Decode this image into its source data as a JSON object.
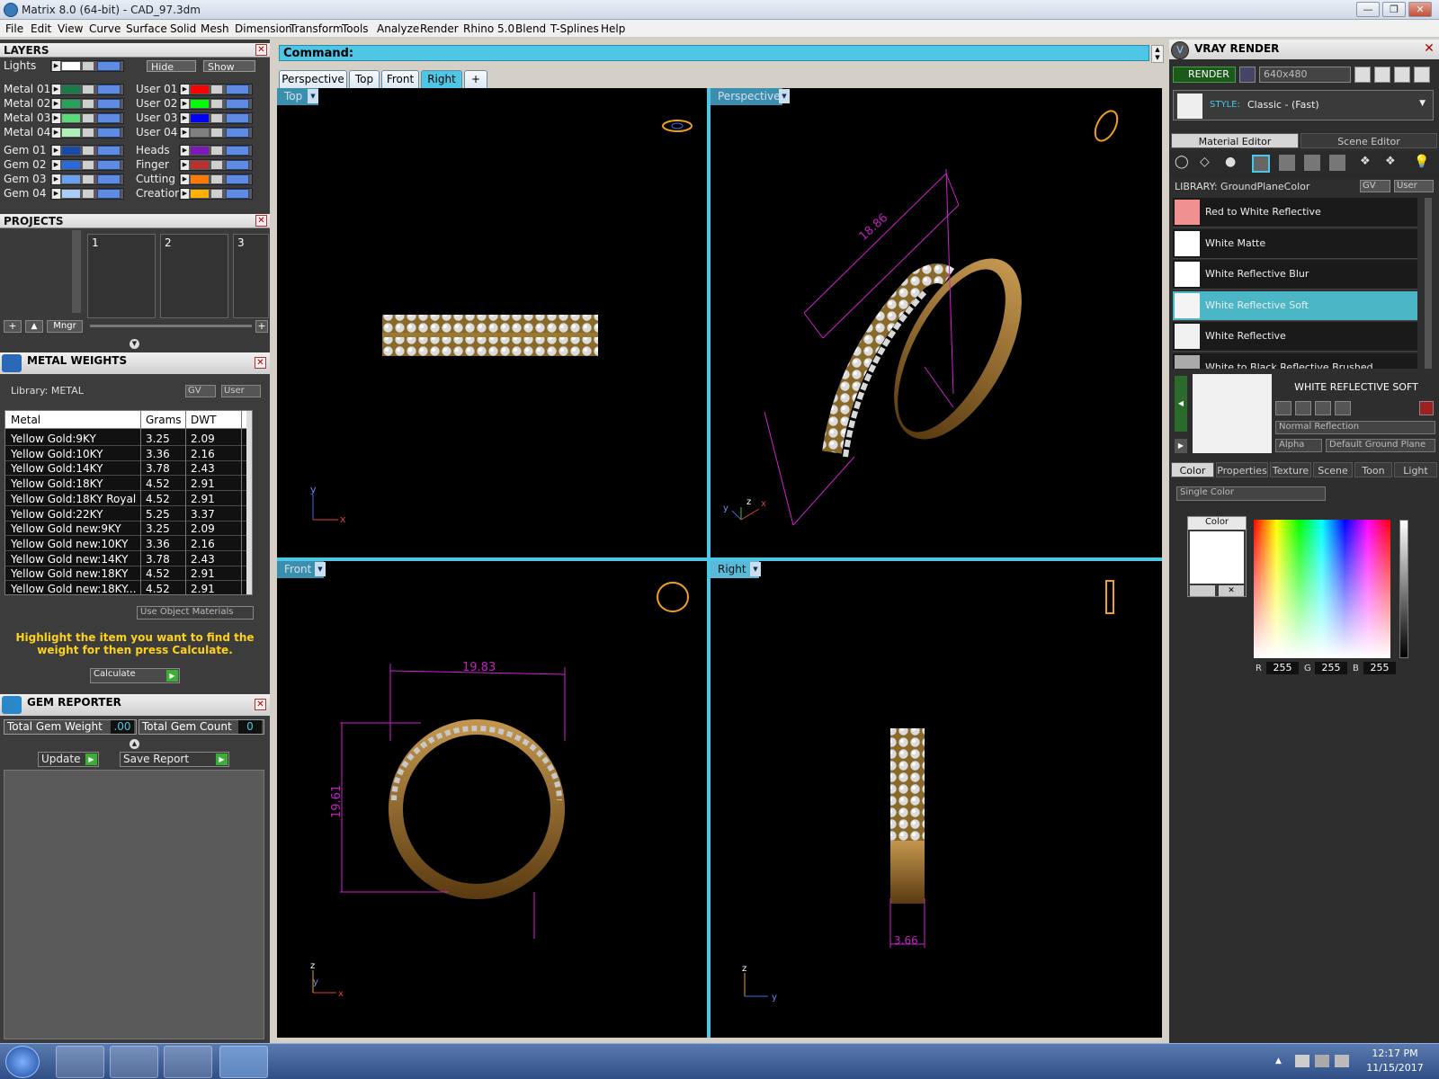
{
  "window": {
    "title": "Matrix 8.0 (64-bit) - CAD_97.3dm",
    "min": "—",
    "max": "❐",
    "close": "✕"
  },
  "menu": [
    "File",
    "Edit",
    "View",
    "Curve",
    "Surface",
    "Solid",
    "Mesh",
    "Dimension",
    "Transform",
    "Tools",
    "Analyze",
    "Render",
    "Rhino 5.0",
    "Blend",
    "T-Splines",
    "Help"
  ],
  "layers_panel": {
    "title": "LAYERS",
    "lights_label": "Lights",
    "hide_label": "Hide",
    "show_label": "Show",
    "left_layers": [
      {
        "name": "Metal 01",
        "color": "#1a7a4a"
      },
      {
        "name": "Metal 02",
        "color": "#2aa05a"
      },
      {
        "name": "Metal 03",
        "color": "#5ad87a"
      },
      {
        "name": "Metal 04",
        "color": "#aef0b8"
      },
      {
        "name": "Gem 01",
        "color": "#1a4aaa"
      },
      {
        "name": "Gem 02",
        "color": "#2a6ad8"
      },
      {
        "name": "Gem 03",
        "color": "#6aa0f0"
      },
      {
        "name": "Gem 04",
        "color": "#aacdf8"
      }
    ],
    "right_layers": [
      {
        "name": "User 01",
        "color": "#ff0000"
      },
      {
        "name": "User 02",
        "color": "#00ff00"
      },
      {
        "name": "User 03",
        "color": "#0000ff"
      },
      {
        "name": "User 04",
        "color": "#808080"
      },
      {
        "name": "Heads",
        "color": "#7a1ab8"
      },
      {
        "name": "Finger",
        "color": "#b83030"
      },
      {
        "name": "Cutting",
        "color": "#ff7a00"
      },
      {
        "name": "Creation",
        "color": "#ffb000"
      }
    ]
  },
  "projects_panel": {
    "title": "PROJECTS",
    "slots": [
      "1",
      "2",
      "3"
    ],
    "mngr_label": "Mngr"
  },
  "metal_weights": {
    "title": "METAL WEIGHTS",
    "library_label": "Library: METAL",
    "gv_label": "GV",
    "user_label": "User",
    "columns": [
      "Metal",
      "Grams",
      "DWT"
    ],
    "rows": [
      [
        "Yellow Gold:9KY",
        "3.25",
        "2.09"
      ],
      [
        "Yellow Gold:10KY",
        "3.36",
        "2.16"
      ],
      [
        "Yellow Gold:14KY",
        "3.78",
        "2.43"
      ],
      [
        "Yellow Gold:18KY",
        "4.52",
        "2.91"
      ],
      [
        "Yellow Gold:18KY Royal",
        "4.52",
        "2.91"
      ],
      [
        "Yellow Gold:22KY",
        "5.25",
        "3.37"
      ],
      [
        "Yellow Gold new:9KY",
        "3.25",
        "2.09"
      ],
      [
        "Yellow Gold new:10KY",
        "3.36",
        "2.16"
      ],
      [
        "Yellow Gold new:14KY",
        "3.78",
        "2.43"
      ],
      [
        "Yellow Gold new:18KY",
        "4.52",
        "2.91"
      ],
      [
        "Yellow Gold new:18KY...",
        "4.52",
        "2.91"
      ]
    ],
    "use_object_materials": "Use Object Materials",
    "hint": "Highlight the item you want to find the weight for then press Calculate.",
    "calculate_label": "Calculate"
  },
  "gem_reporter": {
    "title": "GEM REPORTER",
    "total_weight_label": "Total Gem Weight",
    "total_weight_value": ".00",
    "total_count_label": "Total Gem Count",
    "total_count_value": "0",
    "update_label": "Update",
    "save_report_label": "Save Report"
  },
  "command": {
    "label": "Command:"
  },
  "view_tabs": [
    "Perspective",
    "Top",
    "Front",
    "Right"
  ],
  "active_view_tab": "Right",
  "add_tab": "+",
  "viewports": [
    {
      "name": "Top",
      "axes": [
        "y",
        "x"
      ]
    },
    {
      "name": "Perspective",
      "axes": [
        "z",
        "x",
        "y"
      ]
    },
    {
      "name": "Front",
      "axes": [
        "z",
        "y",
        "x"
      ]
    },
    {
      "name": "Right",
      "axes": [
        "z",
        "y"
      ]
    }
  ],
  "dimensions": {
    "persp_length": "18.86",
    "front_width": "19.83",
    "front_height": "19.61",
    "right_width": "3.66"
  },
  "vray": {
    "title": "VRAY RENDER",
    "render_label": "RENDER",
    "resolution": "640x480",
    "style_label": "STYLE:",
    "style_value": "Classic - (Fast)",
    "tabs": [
      "Material Editor",
      "Scene Editor"
    ],
    "library_label": "LIBRARY: GroundPlaneColor",
    "gv_label": "GV",
    "user_label": "User",
    "materials": [
      {
        "name": "Red to White Reflective",
        "chip": "#f09090"
      },
      {
        "name": "White Matte",
        "chip": "#ffffff"
      },
      {
        "name": "White Reflective Blur",
        "chip": "#ffffff"
      },
      {
        "name": "White Reflective Soft",
        "chip": "#f4f4f4"
      },
      {
        "name": "White Reflective",
        "chip": "#f0f0f0"
      },
      {
        "name": "White to Black Reflective Brushed",
        "chip": "#aaaaaa"
      }
    ],
    "selected_material": "WHITE REFLECTIVE SOFT",
    "reflection_mode": "Normal Reflection",
    "alpha_label": "Alpha",
    "ground_plane_label": "Default Ground Plane",
    "prop_tabs": [
      "Color",
      "Properties",
      "Texture",
      "Scene",
      "Toon",
      "Light"
    ],
    "color_mode": "Single Color",
    "color_label": "Color",
    "rgb": {
      "r_label": "R",
      "r": "255",
      "g_label": "G",
      "g": "255",
      "b_label": "B",
      "b": "255"
    }
  },
  "taskbar": {
    "time": "12:17 PM",
    "date": "11/15/2017"
  },
  "accent": "#4ec6e6"
}
